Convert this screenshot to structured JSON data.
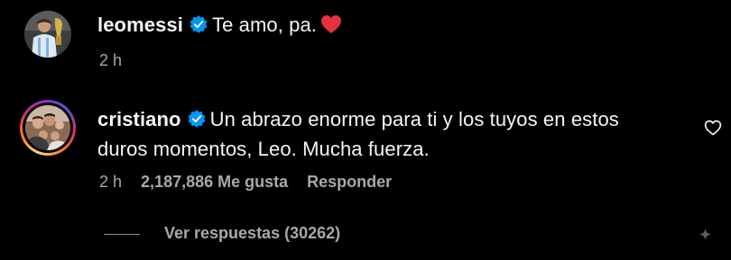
{
  "comments": [
    {
      "username": "leomessi",
      "text": "Te amo, pa.",
      "emoji_icon": "red-heart-icon",
      "time": "2 h"
    },
    {
      "username": "cristiano",
      "text": "Un abrazo enorme para ti y los tuyos en estos",
      "text_line2": "duros momentos, Leo. Mucha fuerza.",
      "time": "2 h",
      "likes": "2,187,886 Me gusta",
      "reply_label": "Responder"
    }
  ],
  "replies_label": "Ver respuestas (30262)",
  "icons": {
    "verified": "verified-badge-icon",
    "like": "heart-outline-icon",
    "more": "sparkle-icon"
  },
  "colors": {
    "background": "#000000",
    "text": "#f5f5f5",
    "muted": "#a8a8a8",
    "verified": "#0095f6",
    "heart": "#ed4956"
  }
}
